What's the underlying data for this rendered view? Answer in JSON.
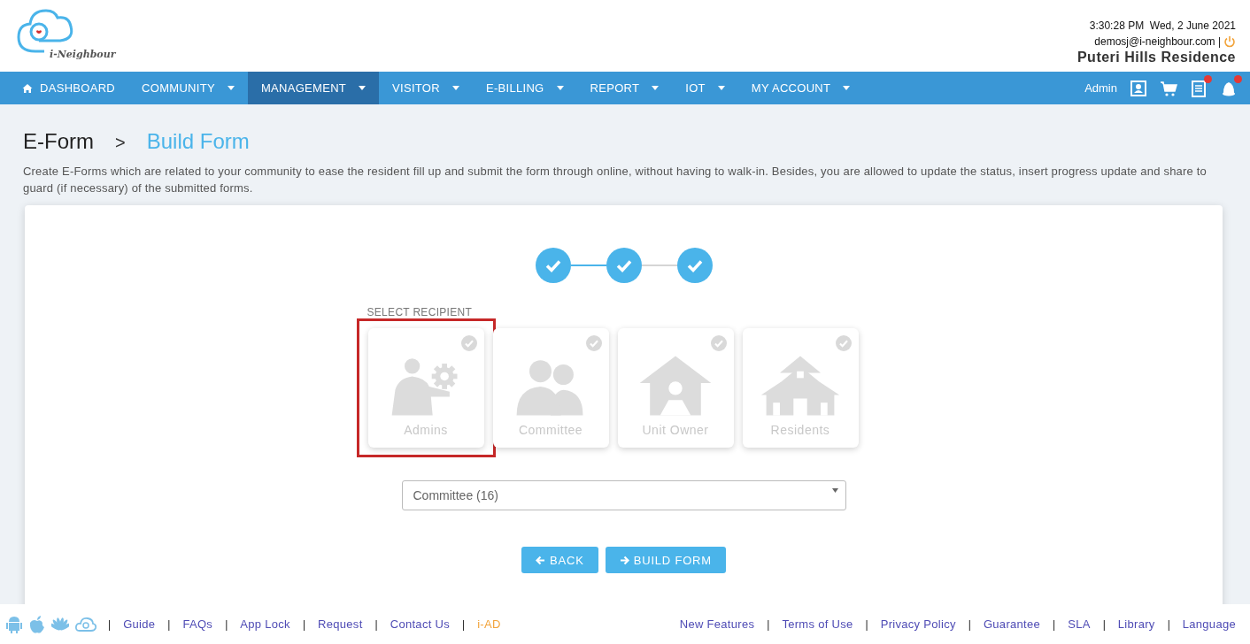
{
  "header": {
    "logo_text": "i-Neighbour",
    "datetime": "3:30:28 PM  Wed, 2 June 2021",
    "email": "demosj@i-neighbour.com |",
    "residence": "Puteri Hills Residence"
  },
  "nav": {
    "items": [
      {
        "label": "DASHBOARD",
        "kind": "home",
        "selected": false
      },
      {
        "label": "COMMUNITY",
        "kind": "menu",
        "selected": false
      },
      {
        "label": "MANAGEMENT",
        "kind": "menu",
        "selected": true
      },
      {
        "label": "VISITOR",
        "kind": "menu",
        "selected": false
      },
      {
        "label": "E-BILLING",
        "kind": "menu",
        "selected": false
      },
      {
        "label": "REPORT",
        "kind": "menu",
        "selected": false
      },
      {
        "label": "IOT",
        "kind": "menu",
        "selected": false
      },
      {
        "label": "MY ACCOUNT",
        "kind": "menu",
        "selected": false
      }
    ],
    "user": "Admin",
    "tools": [
      {
        "kind": "contact",
        "badge": false
      },
      {
        "kind": "cart",
        "badge": false
      },
      {
        "kind": "notes",
        "badge": true
      },
      {
        "kind": "bell",
        "badge": true
      }
    ]
  },
  "breadcrumb": {
    "parent": "E-Form",
    "separator": ">",
    "current": "Build Form"
  },
  "description": "Create E-Forms which are related to your community to ease the resident fill up and submit the form through online, without having to walk-in. Besides, you are allowed to update the status, insert progress update and share to guard (if necessary) of the submitted forms.",
  "steps": [
    {
      "done": true
    },
    {
      "done": true
    },
    {
      "done": true
    }
  ],
  "connectors": [
    {
      "active": true
    },
    {
      "active": false
    }
  ],
  "recipient": {
    "label": "SELECT RECIPIENT",
    "options": [
      {
        "label": "Admins",
        "kind": "admin",
        "selected": true
      },
      {
        "label": "Committee",
        "kind": "committee",
        "selected": false
      },
      {
        "label": "Unit Owner",
        "kind": "owner",
        "selected": false
      },
      {
        "label": "Residents",
        "kind": "residents",
        "selected": false
      }
    ]
  },
  "dropdown": {
    "value": "Committee (16)"
  },
  "buttons": [
    {
      "label": "BACK",
      "kind": "back"
    },
    {
      "label": "BUILD FORM",
      "kind": "next"
    }
  ],
  "footer": {
    "left": [
      {
        "kind": "sep",
        "text": "|"
      },
      {
        "kind": "link",
        "text": "Guide",
        "color": "#4f4cb5"
      },
      {
        "kind": "sep",
        "text": "|"
      },
      {
        "kind": "link",
        "text": "FAQs",
        "color": "#4f4cb5"
      },
      {
        "kind": "sep",
        "text": "|"
      },
      {
        "kind": "link",
        "text": "App Lock",
        "color": "#4f4cb5"
      },
      {
        "kind": "sep",
        "text": "|"
      },
      {
        "kind": "link",
        "text": "Request",
        "color": "#4f4cb5"
      },
      {
        "kind": "sep",
        "text": "|"
      },
      {
        "kind": "link",
        "text": "Contact Us",
        "color": "#4f4cb5"
      },
      {
        "kind": "sep",
        "text": "|"
      },
      {
        "kind": "link",
        "text": "i-AD",
        "color": "#f2a33a"
      }
    ],
    "right": [
      {
        "kind": "link",
        "text": "New Features",
        "color": "#4f4cb5"
      },
      {
        "kind": "sep",
        "text": "|"
      },
      {
        "kind": "link",
        "text": "Terms of Use",
        "color": "#4f4cb5"
      },
      {
        "kind": "sep",
        "text": "|"
      },
      {
        "kind": "link",
        "text": "Privacy Policy",
        "color": "#4f4cb5"
      },
      {
        "kind": "sep",
        "text": "|"
      },
      {
        "kind": "link",
        "text": "Guarantee",
        "color": "#4f4cb5"
      },
      {
        "kind": "sep",
        "text": "|"
      },
      {
        "kind": "link",
        "text": "SLA",
        "color": "#4f4cb5"
      },
      {
        "kind": "sep",
        "text": "|"
      },
      {
        "kind": "link",
        "text": "Library",
        "color": "#4f4cb5"
      },
      {
        "kind": "sep",
        "text": "|"
      },
      {
        "kind": "link",
        "text": "Language",
        "color": "#4f4cb5"
      }
    ]
  }
}
